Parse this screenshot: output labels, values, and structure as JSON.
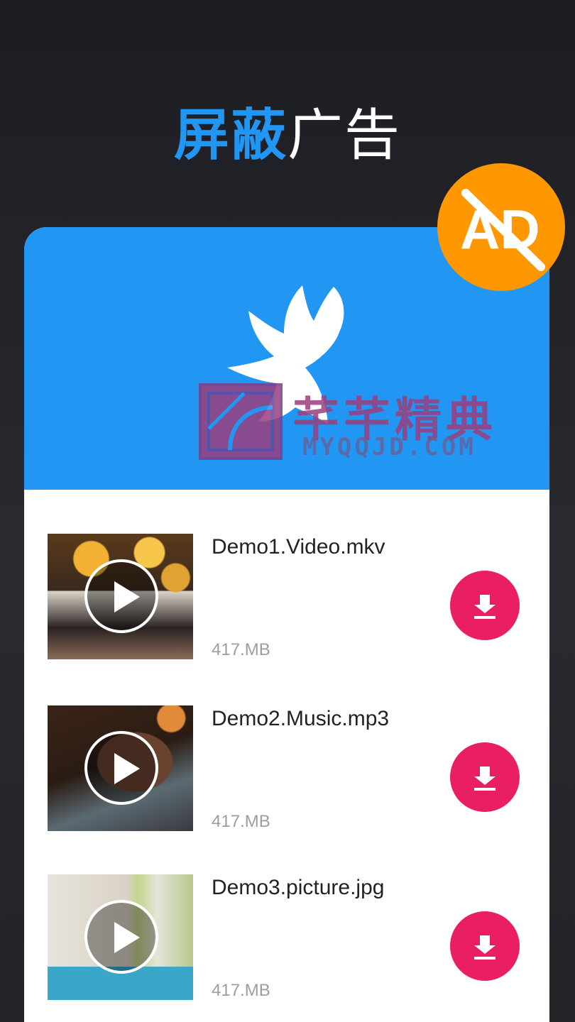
{
  "headline": {
    "accent": "屏蔽",
    "rest": "广告"
  },
  "ad_badge": {
    "icon": "ad-block-icon",
    "text": "AD",
    "color": "#ff9800"
  },
  "hero": {
    "icon": "bird-icon",
    "color": "#2196f3"
  },
  "watermark": {
    "text": "芊芊精典",
    "sub": "MYQQJD.COM"
  },
  "files": [
    {
      "name": "Demo1.Video.mkv",
      "size": "417.MB"
    },
    {
      "name": "Demo2.Music.mp3",
      "size": "417.MB"
    },
    {
      "name": "Demo3.picture.jpg",
      "size": "417.MB"
    }
  ],
  "download": {
    "icon": "download-icon",
    "color": "#e91e63"
  }
}
